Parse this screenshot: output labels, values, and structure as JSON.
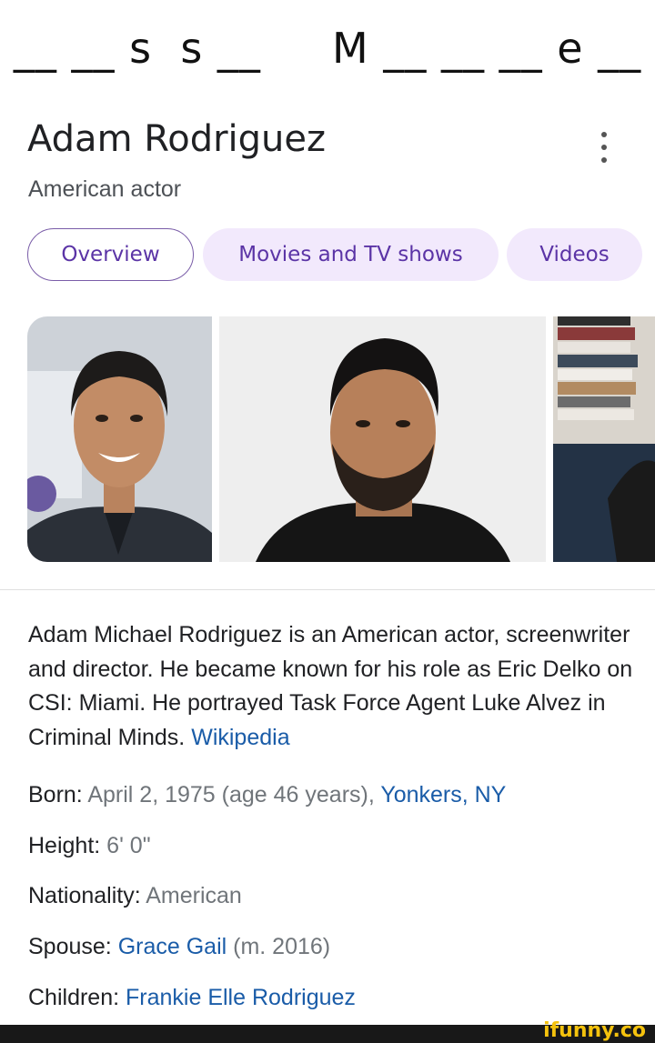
{
  "puzzle": {
    "text": "__ __ s  s __     M __ __ __ e __"
  },
  "entity": {
    "name": "Adam Rodriguez",
    "subtitle": "American actor"
  },
  "more_icon": "more-vert-icon",
  "tabs": [
    {
      "label": "Overview",
      "active": true
    },
    {
      "label": "Movies and TV shows",
      "active": false
    },
    {
      "label": "Videos",
      "active": false
    }
  ],
  "description": {
    "text": "Adam Michael Rodriguez is an American actor, screenwriter and director. He became known for his role as Eric Delko on CSI: Miami. He portrayed Task Force Agent Luke Alvez in Criminal Minds.",
    "source": "Wikipedia"
  },
  "facts": {
    "born": {
      "label": "Born:",
      "value": "April 2, 1975 (age 46 years),",
      "link": "Yonkers, NY"
    },
    "height": {
      "label": "Height:",
      "value": "6' 0\""
    },
    "nationality": {
      "label": "Nationality:",
      "value": "American"
    },
    "spouse": {
      "label": "Spouse:",
      "link": "Grace Gail",
      "value": "(m. 2016)"
    },
    "children": {
      "label": "Children:",
      "link": "Frankie Elle Rodriguez"
    }
  },
  "footer": {
    "brand": "ifunny.co"
  },
  "colors": {
    "link": "#1a5ca8",
    "chip_text": "#5b34a6",
    "chip_bg": "#f2e9fc"
  }
}
